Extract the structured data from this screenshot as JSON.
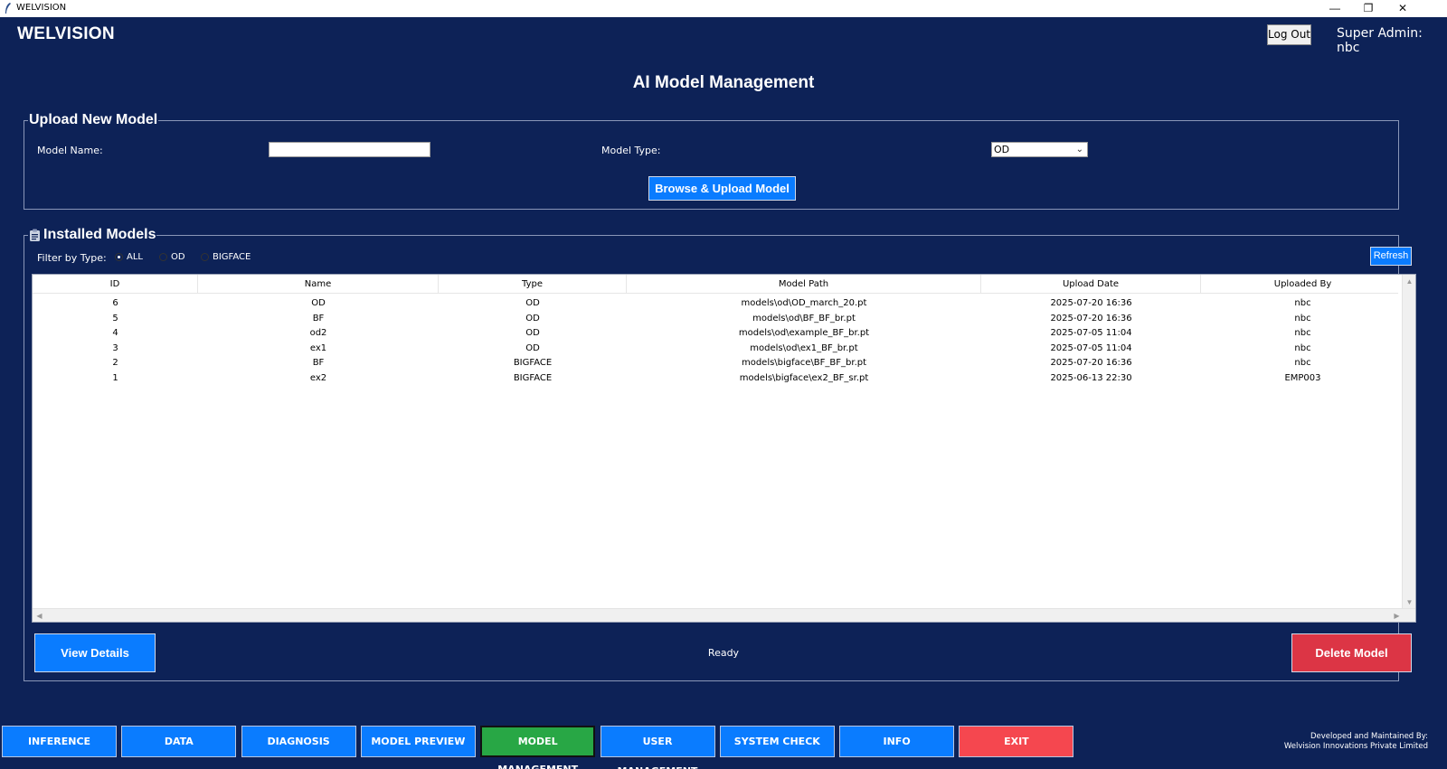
{
  "window": {
    "title": "WELVISION",
    "minimize": "—",
    "restore": "❐",
    "close": "✕"
  },
  "header": {
    "brand": "WELVISION",
    "logout_label": "Log Out",
    "user": "Super Admin: nbc"
  },
  "page_title": "AI Model Management",
  "upload": {
    "group_label": "Upload New Model",
    "model_name_label": "Model Name:",
    "model_name_value": "",
    "model_type_label": "Model Type:",
    "model_type_value": "OD",
    "upload_button": "Browse & Upload Model"
  },
  "installed": {
    "group_label": "Installed Models",
    "filter_label": "Filter by Type:",
    "filters": [
      {
        "label": "ALL",
        "selected": true
      },
      {
        "label": "OD",
        "selected": false
      },
      {
        "label": "BIGFACE",
        "selected": false
      }
    ],
    "refresh_label": "Refresh",
    "columns": [
      "ID",
      "Name",
      "Type",
      "Model Path",
      "Upload Date",
      "Uploaded By"
    ],
    "rows": [
      [
        "6",
        "OD",
        "OD",
        "models\\od\\OD_march_20.pt",
        "2025-07-20 16:36",
        "nbc"
      ],
      [
        "5",
        "BF",
        "OD",
        "models\\od\\BF_BF_br.pt",
        "2025-07-20 16:36",
        "nbc"
      ],
      [
        "4",
        "od2",
        "OD",
        "models\\od\\example_BF_br.pt",
        "2025-07-05 11:04",
        "nbc"
      ],
      [
        "3",
        "ex1",
        "OD",
        "models\\od\\ex1_BF_br.pt",
        "2025-07-05 11:04",
        "nbc"
      ],
      [
        "2",
        "BF",
        "BIGFACE",
        "models\\bigface\\BF_BF_br.pt",
        "2025-07-20 16:36",
        "nbc"
      ],
      [
        "1",
        "ex2",
        "BIGFACE",
        "models\\bigface\\ex2_BF_sr.pt",
        "2025-06-13 22:30",
        "EMP003"
      ]
    ],
    "view_details": "View Details",
    "status": "Ready",
    "delete_model": "Delete Model"
  },
  "nav": [
    {
      "label": "INFERENCE",
      "active": false
    },
    {
      "label": "DATA",
      "active": false
    },
    {
      "label": "DIAGNOSIS",
      "active": false
    },
    {
      "label": "MODEL PREVIEW",
      "active": false
    },
    {
      "label": "MODEL MANAGEMENT",
      "active": true
    },
    {
      "label": "USER MANAGEMENT",
      "active": false
    },
    {
      "label": "SYSTEM CHECK",
      "active": false
    },
    {
      "label": "INFO",
      "active": false
    },
    {
      "label": "EXIT",
      "active": false
    }
  ],
  "footer": {
    "line1": "Developed and Maintained By:",
    "line2": "Welvision Innovations Private Limited"
  },
  "colors": {
    "background": "#0d2257",
    "primary": "#0a7cff",
    "active": "#28a745",
    "danger": "#dc3545",
    "exit": "#f5474f"
  },
  "icons": {
    "app_icon": "feather-icon",
    "section_icon": "clipboard-icon"
  }
}
